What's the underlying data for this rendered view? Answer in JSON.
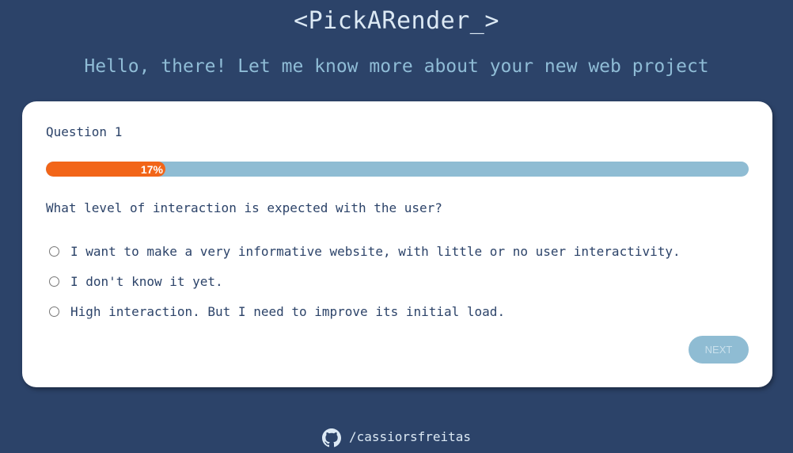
{
  "header": {
    "logo": "<PickARender_>",
    "subtitle": "Hello, there! Let me know more about your new web project"
  },
  "quiz": {
    "question_label": "Question 1",
    "progress": {
      "percent": 17,
      "label": "17%"
    },
    "question_text": "What level of interaction is expected with the user?",
    "options": [
      {
        "label": "I want to make a very informative website, with little or no user interactivity.",
        "selected": false
      },
      {
        "label": "I don't know it yet.",
        "selected": false
      },
      {
        "label": "High interaction. But I need to improve its initial load.",
        "selected": false
      }
    ],
    "next_label": "NEXT"
  },
  "footer": {
    "icon": "github-icon",
    "handle": "/cassiorsfreitas"
  },
  "colors": {
    "background": "#2c4369",
    "accent": "#f26518",
    "progress_track": "#8fbcd3"
  }
}
